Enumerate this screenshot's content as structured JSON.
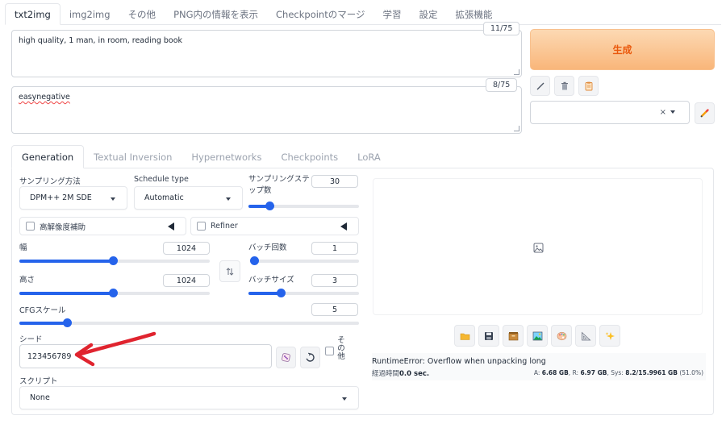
{
  "top_tabs": [
    "txt2img",
    "img2img",
    "その他",
    "PNG内の情報を表示",
    "Checkpointのマージ",
    "学習",
    "設定",
    "拡張機能"
  ],
  "prompt": {
    "text": "high quality, 1 man, in room, reading book",
    "token_count": "11/75"
  },
  "negative_prompt": {
    "text": "easynegative",
    "token_count": "8/75"
  },
  "generate_label": "生成",
  "style_select": {
    "clear": "×"
  },
  "sub_tabs": [
    "Generation",
    "Textual Inversion",
    "Hypernetworks",
    "Checkpoints",
    "LoRA"
  ],
  "sampling_method": {
    "label": "サンプリング方法",
    "value": "DPM++ 2M SDE"
  },
  "schedule_type": {
    "label": "Schedule type",
    "value": "Automatic"
  },
  "sampling_steps": {
    "label": "サンプリングステップ数",
    "value": "30",
    "fraction": 0.19
  },
  "hires_fix": {
    "label": "高解像度補助"
  },
  "refiner": {
    "label": "Refiner"
  },
  "width": {
    "label": "幅",
    "value": "1024",
    "fraction": 0.49
  },
  "height": {
    "label": "高さ",
    "value": "1024",
    "fraction": 0.49
  },
  "batch_count": {
    "label": "バッチ回数",
    "value": "1",
    "fraction": 0.0
  },
  "batch_size": {
    "label": "バッチサイズ",
    "value": "3",
    "fraction": 0.29
  },
  "cfg_scale": {
    "label": "CFGスケール",
    "value": "5",
    "fraction": 0.14
  },
  "seed": {
    "label": "シード",
    "value": "123456789"
  },
  "extra": {
    "label": "その他"
  },
  "script": {
    "label": "スクリプト",
    "value": "None"
  },
  "output": {
    "error": "RuntimeError: Overflow when unpacking long",
    "time_label": "経過時間",
    "time_value": "0.0 sec.",
    "vram_a_label": "A: ",
    "vram_a": "6.68 GB",
    "vram_r_label": ", R: ",
    "vram_r": "6.97 GB",
    "vram_sys_label": ", Sys: ",
    "vram_sys": "8.2/15.9961 GB",
    "vram_pct": " (51.0%)"
  },
  "colors": {
    "accent": "#2563eb",
    "generate_bg": "#f9b67a",
    "generate_text": "#ea580c",
    "arrow": "#e0242f"
  }
}
